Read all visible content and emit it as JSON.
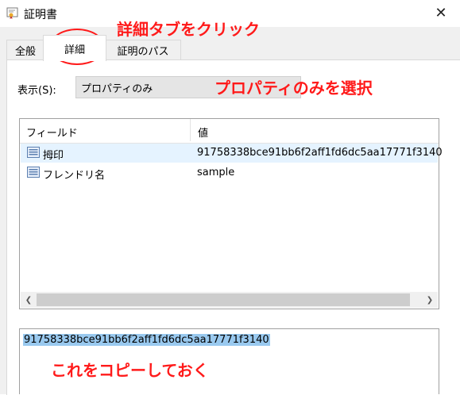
{
  "window": {
    "title": "証明書",
    "close_icon": "close-icon"
  },
  "tabs": [
    {
      "label": "全般"
    },
    {
      "label": "詳細"
    },
    {
      "label": "証明のパス"
    }
  ],
  "show": {
    "label": "表示(S):",
    "selected": "プロパティのみ"
  },
  "list": {
    "columns": [
      "フィールド",
      "値"
    ],
    "rows": [
      {
        "icon": "certificate-field-icon",
        "name": "拇印",
        "value": "91758338bce91bb6f2aff1fd6dc5aa17771f3140"
      },
      {
        "icon": "certificate-field-icon",
        "name": "フレンドリ名",
        "value": "sample"
      }
    ]
  },
  "detail_value": "91758338bce91bb6f2aff1fd6dc5aa17771f3140",
  "annotations": {
    "click_tab": "詳細タブをクリック",
    "select_props": "プロパティのみを選択",
    "copy_this": "これをコピーしておく",
    "color": "#ff1a1a"
  }
}
